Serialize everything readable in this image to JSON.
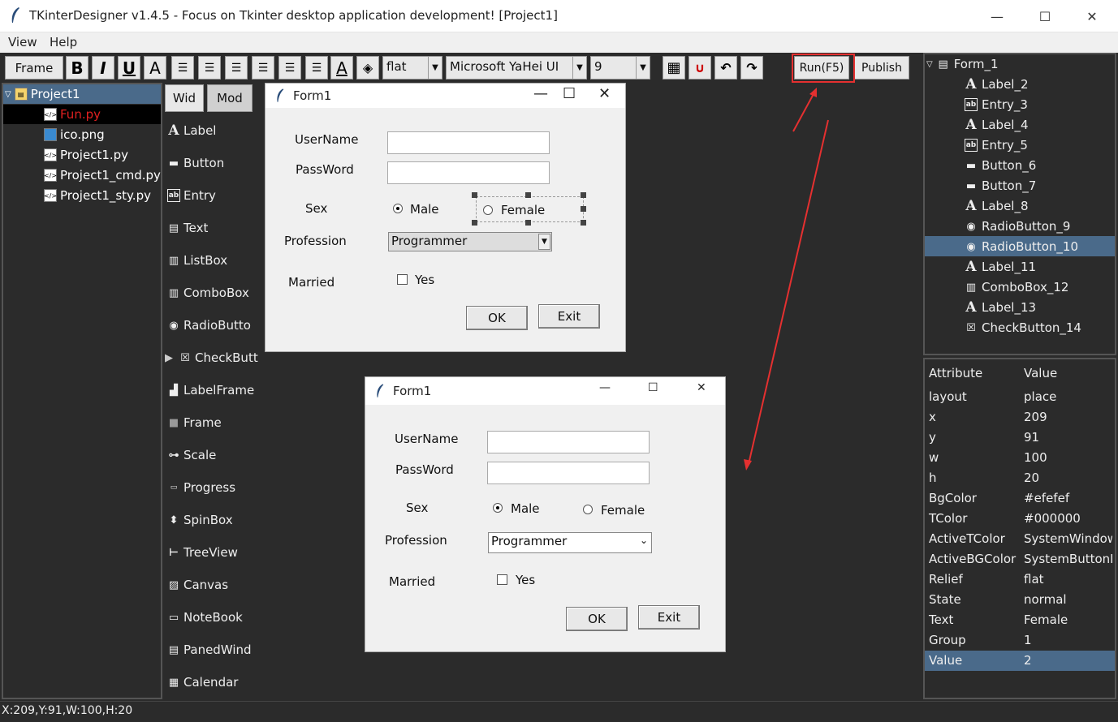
{
  "window": {
    "title": "TKinterDesigner v1.4.5 - Focus on Tkinter desktop application development!   [Project1]"
  },
  "menu": {
    "view": "View",
    "help": "Help"
  },
  "toolbar": {
    "frame_label": "Frame",
    "bold": "B",
    "italic": "I",
    "underline": "U",
    "font_a": "A",
    "color_a": "A",
    "relief": "flat",
    "font_family": "Microsoft YaHei UI",
    "font_size": "9",
    "run_label": "Run(F5)",
    "publish_label": "Publish"
  },
  "project_tree": {
    "root": "Project1",
    "files": [
      "Fun.py",
      "ico.png",
      "Project1.py",
      "Project1_cmd.py",
      "Project1_sty.py"
    ]
  },
  "widget_tabs": {
    "tab1": "Wid",
    "tab2": "Mod"
  },
  "widgets": [
    "Label",
    "Button",
    "Entry",
    "Text",
    "ListBox",
    "ComboBox",
    "RadioButto",
    "CheckButt",
    "LabelFrame",
    "Frame",
    "Scale",
    "Progress",
    "SpinBox",
    "TreeView",
    "Canvas",
    "NoteBook",
    "PanedWind",
    "Calendar"
  ],
  "design_form": {
    "title": "Form1",
    "username_label": "UserName",
    "password_label": "PassWord",
    "sex_label": "Sex",
    "male_label": "Male",
    "female_label": "Female",
    "profession_label": "Profession",
    "profession_value": "Programmer",
    "married_label": "Married",
    "yes_label": "Yes",
    "ok_label": "OK",
    "exit_label": "Exit"
  },
  "run_form": {
    "title": "Form1",
    "username_label": "UserName",
    "password_label": "PassWord",
    "sex_label": "Sex",
    "male_label": "Male",
    "female_label": "Female",
    "profession_label": "Profession",
    "profession_value": "Programmer",
    "married_label": "Married",
    "yes_label": "Yes",
    "ok_label": "OK",
    "exit_label": "Exit"
  },
  "control_tree": {
    "root": "Form_1",
    "items": [
      "Label_2",
      "Entry_3",
      "Label_4",
      "Entry_5",
      "Button_6",
      "Button_7",
      "Label_8",
      "RadioButton_9",
      "RadioButton_10",
      "Label_11",
      "ComboBox_12",
      "Label_13",
      "CheckButton_14"
    ],
    "selected": "RadioButton_10"
  },
  "attributes": {
    "header_attr": "Attribute",
    "header_value": "Value",
    "rows": [
      {
        "name": "layout",
        "value": "place"
      },
      {
        "name": "x",
        "value": "209"
      },
      {
        "name": "y",
        "value": "91"
      },
      {
        "name": "w",
        "value": "100"
      },
      {
        "name": "h",
        "value": "20"
      },
      {
        "name": "BgColor",
        "value": "#efefef"
      },
      {
        "name": "TColor",
        "value": "#000000"
      },
      {
        "name": "ActiveTColor",
        "value": "SystemWindow"
      },
      {
        "name": "ActiveBGColor",
        "value": "SystemButtonF"
      },
      {
        "name": "Relief",
        "value": "flat"
      },
      {
        "name": "State",
        "value": "normal"
      },
      {
        "name": "Text",
        "value": "Female"
      },
      {
        "name": "Group",
        "value": "1"
      },
      {
        "name": "Value",
        "value": "2"
      }
    ]
  },
  "status": {
    "text": "X:209,Y:91,W:100,H:20"
  },
  "colors": {
    "selected_row": "#4a6a8a",
    "highlight_box": "#e53030",
    "arrow": "#e53030"
  }
}
